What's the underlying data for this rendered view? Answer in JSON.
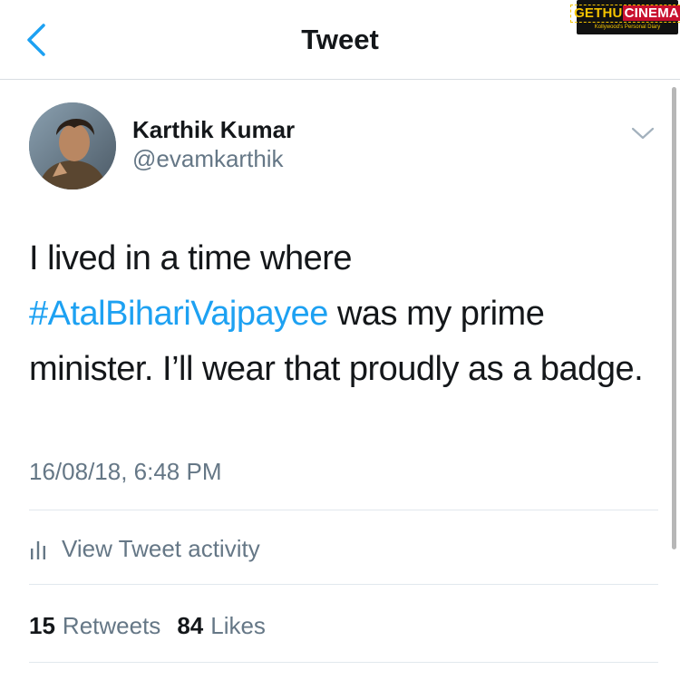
{
  "navbar": {
    "title": "Tweet",
    "back_icon": "chevron-left-icon"
  },
  "watermark": {
    "brand_left": "GETHU",
    "brand_right": "CINEMA",
    "tagline": "Kollywood's Personal Diary"
  },
  "tweet": {
    "author_name": "Karthik Kumar",
    "author_handle": "@evamkarthik",
    "text_before": "I lived in a time where ",
    "hashtag": "#AtalBihariVajpayee",
    "text_after": " was my prime minister. I’ll wear that proudly as a badge.",
    "timestamp": "16/08/18, 6:48 PM",
    "activity_label": "View Tweet activity",
    "retweets_count": "15",
    "retweets_label": "Retweets",
    "likes_count": "84",
    "likes_label": "Likes"
  },
  "colors": {
    "accent": "#1da1f2",
    "secondary_text": "#657786",
    "primary_text": "#14171a",
    "divider": "#e1e8ed"
  }
}
